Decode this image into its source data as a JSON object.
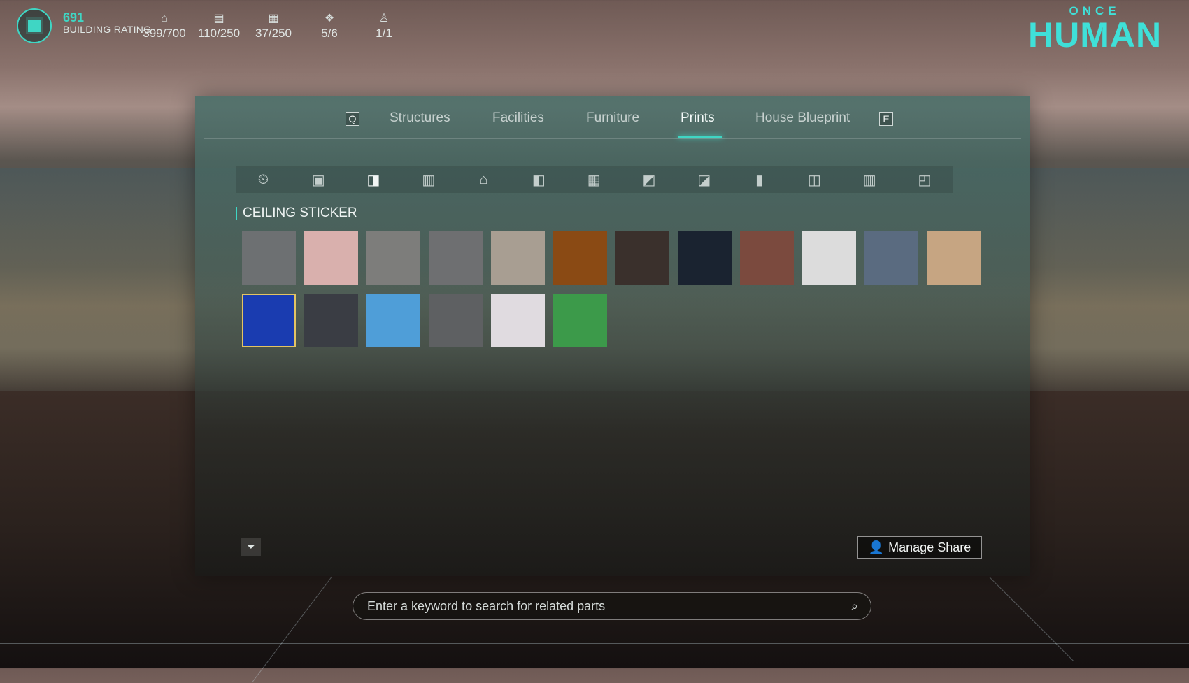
{
  "hud": {
    "rating_value": "691",
    "rating_label": "BUILDING RATING",
    "stats": [
      {
        "icon": "house-icon",
        "glyph": "⌂",
        "value": "399/700"
      },
      {
        "icon": "storage-icon",
        "glyph": "▤",
        "value": "110/250"
      },
      {
        "icon": "crafting-icon",
        "glyph": "▦",
        "value": "37/250"
      },
      {
        "icon": "territory-icon",
        "glyph": "❖",
        "value": "5/6"
      },
      {
        "icon": "deviation-icon",
        "glyph": "♙",
        "value": "1/1"
      }
    ]
  },
  "logo": {
    "top": "ONCE",
    "main": "HUMAN"
  },
  "tabs": {
    "prev_key": "Q",
    "next_key": "E",
    "items": [
      "Structures",
      "Facilities",
      "Furniture",
      "Prints",
      "House Blueprint"
    ],
    "active": "Prints"
  },
  "categories": [
    {
      "icon": "recent-icon",
      "glyph": "⏲"
    },
    {
      "icon": "floor-print-icon",
      "glyph": "▣"
    },
    {
      "icon": "ceiling-print-icon",
      "glyph": "◨"
    },
    {
      "icon": "wall-print-icon",
      "glyph": "▥"
    },
    {
      "icon": "roof-print-icon",
      "glyph": "⌂"
    },
    {
      "icon": "door-print-icon",
      "glyph": "◧"
    },
    {
      "icon": "window-print-icon",
      "glyph": "▦"
    },
    {
      "icon": "stair-print-icon",
      "glyph": "◩"
    },
    {
      "icon": "railing-print-icon",
      "glyph": "◪"
    },
    {
      "icon": "pillar-print-icon",
      "glyph": "▮"
    },
    {
      "icon": "frame-print-icon",
      "glyph": "◫"
    },
    {
      "icon": "fence-print-icon",
      "glyph": "▥"
    },
    {
      "icon": "misc-print-icon",
      "glyph": "◰"
    }
  ],
  "active_category_index": 2,
  "section": {
    "title": "CEILING STICKER"
  },
  "tiles": [
    {
      "name": "grey-hexagon-tile",
      "color": "#6d7072"
    },
    {
      "name": "pink-square-tile",
      "color": "#d9b0ad"
    },
    {
      "name": "grey-stone-tile",
      "color": "#7d7d7b"
    },
    {
      "name": "striped-metal-tile",
      "color": "#6e6f71"
    },
    {
      "name": "beige-plaster-tile",
      "color": "#a89e92"
    },
    {
      "name": "rust-orange-tile",
      "color": "#8a4a14"
    },
    {
      "name": "dark-wood-panel-tile",
      "color": "#3a302c"
    },
    {
      "name": "night-sky-tile",
      "color": "#1a2330"
    },
    {
      "name": "red-brick-cross-tile",
      "color": "#7b4a3e"
    },
    {
      "name": "white-panel-tile",
      "color": "#dcdcdc"
    },
    {
      "name": "blue-steel-tile",
      "color": "#5a6b80"
    },
    {
      "name": "light-wood-tile",
      "color": "#c6a582"
    },
    {
      "name": "blue-glass-tile",
      "color": "#1a3cb0",
      "selected": true
    },
    {
      "name": "dark-parquet-tile",
      "color": "#3a3d44"
    },
    {
      "name": "blue-mosaic-tile",
      "color": "#4f9ed8"
    },
    {
      "name": "grey-concrete-tile",
      "color": "#5e6062"
    },
    {
      "name": "white-marble-tile",
      "color": "#e0dbe0"
    },
    {
      "name": "green-tile",
      "color": "#3c9a4a"
    }
  ],
  "footer": {
    "filter_icon": "filter-icon",
    "manage_share_label": "Manage Share",
    "manage_share_icon": "share-user-icon"
  },
  "search": {
    "placeholder": "Enter a keyword to search for related parts",
    "icon": "search-icon"
  }
}
